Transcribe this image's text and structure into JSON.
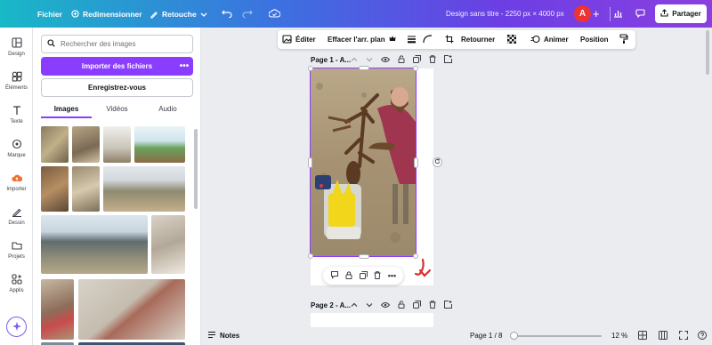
{
  "topbar": {
    "file_label": "Fichier",
    "resize_label": "Redimensionner",
    "retouch_label": "Retouche",
    "doc_title": "Design sans titre - 2250 px × 4000 px",
    "avatar_initial": "A",
    "share_label": "Partager"
  },
  "rail": {
    "items": [
      {
        "label": "Design",
        "icon": "layout-icon"
      },
      {
        "label": "Éléments",
        "icon": "shapes-icon"
      },
      {
        "label": "Texte",
        "icon": "text-icon"
      },
      {
        "label": "Marque",
        "icon": "brand-icon"
      },
      {
        "label": "Importer",
        "icon": "cloud-upload-icon"
      },
      {
        "label": "Dessin",
        "icon": "pen-icon"
      },
      {
        "label": "Projets",
        "icon": "folder-icon"
      },
      {
        "label": "Applis",
        "icon": "apps-icon"
      }
    ]
  },
  "panel": {
    "search_placeholder": "Rechercher des images",
    "upload_label": "Importer des fichiers",
    "record_label": "Enregistrez-vous",
    "tabs": [
      "Images",
      "Vidéos",
      "Audio"
    ],
    "active_tab": "Images"
  },
  "context_bar": {
    "edit": "Éditer",
    "erase_bg": "Effacer l'arr. plan",
    "flip": "Retourner",
    "animate": "Animer",
    "position": "Position"
  },
  "pages": {
    "page1_label": "Page 1 - A...",
    "page2_label": "Page 2 - A..."
  },
  "bottombar": {
    "notes_label": "Notes",
    "page_indicator": "Page 1 / 8",
    "zoom": "12 %"
  },
  "colors": {
    "accent": "#8b3dff",
    "topbar_start": "#19b8c7",
    "topbar_end": "#8b3fe0",
    "avatar": "#e33333"
  }
}
